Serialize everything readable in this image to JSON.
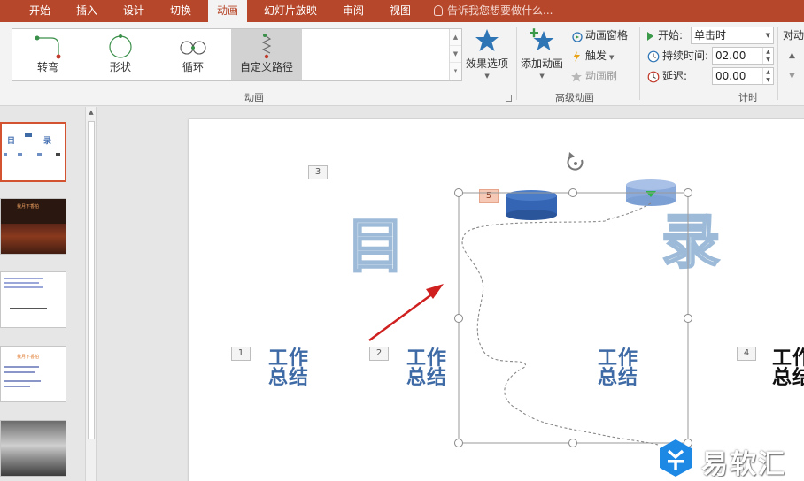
{
  "tabs": [
    {
      "label": "开始",
      "active": false
    },
    {
      "label": "插入",
      "active": false
    },
    {
      "label": "设计",
      "active": false
    },
    {
      "label": "切换",
      "active": false
    },
    {
      "label": "动画",
      "active": true
    },
    {
      "label": "幻灯片放映",
      "active": false
    },
    {
      "label": "审阅",
      "active": false
    },
    {
      "label": "视图",
      "active": false
    }
  ],
  "tellme": "告诉我您想要做什么...",
  "animation_gallery": {
    "items": [
      {
        "label": "转弯",
        "icon": "turn-path-icon"
      },
      {
        "label": "形状",
        "icon": "circle-path-icon"
      },
      {
        "label": "循环",
        "icon": "loop-path-icon"
      },
      {
        "label": "自定义路径",
        "icon": "custom-path-icon",
        "selected": true
      }
    ],
    "effect_options": "效果选项",
    "group_label": "动画"
  },
  "advanced": {
    "add_animation": "添加动画",
    "animation_pane": "动画窗格",
    "trigger": "触发",
    "painter": "动画刷",
    "group_label": "高级动画"
  },
  "timing": {
    "start_label": "开始:",
    "start_value": "单击时",
    "duration_label": "持续时间:",
    "duration_value": "02.00",
    "delay_label": "延迟:",
    "delay_value": "00.00",
    "reorder_label": "对动",
    "group_label": "计时"
  },
  "slide": {
    "tags": [
      "3",
      "5",
      "1",
      "2",
      "4"
    ],
    "title_left": "目",
    "title_right": "录",
    "work_text": "工作\n总结"
  },
  "thumbnails": {
    "thumb1": {
      "left": "目",
      "right": "录"
    },
    "thumb2": {
      "title": "我月下香柏"
    },
    "thumb4": {
      "title": "我月下香柏"
    }
  },
  "watermark": {
    "text": "易软汇"
  },
  "colors": {
    "accent": "#b7472a",
    "selection_handle": "#999999",
    "title_stroke": "#9dbbd8",
    "work_text": "#3e6aa5"
  }
}
